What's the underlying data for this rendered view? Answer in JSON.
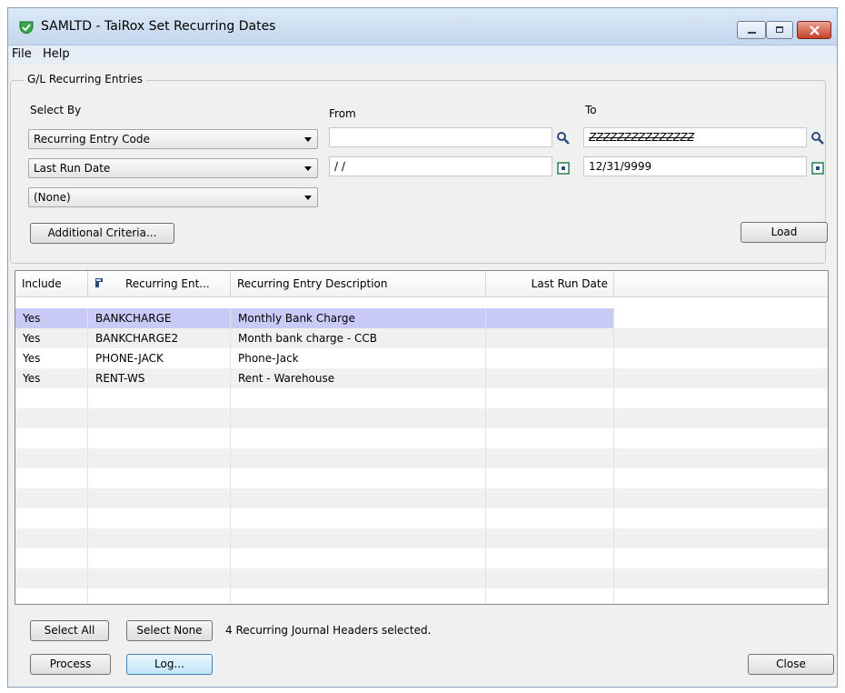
{
  "window": {
    "title": "SAMLTD - TaiRox Set Recurring Dates"
  },
  "menu": [
    "File",
    "Help"
  ],
  "criteria": {
    "group_label": "G/L Recurring Entries",
    "select_by_label": "Select By",
    "from_label": "From",
    "to_label": "To",
    "rows": [
      {
        "select_by": "Recurring Entry Code",
        "from": "",
        "to": "ZZZZZZZZZZZZZZZ",
        "icon": "search-icon"
      },
      {
        "select_by": "Last Run Date",
        "from": "/ /",
        "to": "12/31/9999",
        "icon": "calendar-icon"
      },
      {
        "select_by": "(None)"
      }
    ],
    "additional_criteria_label": "Additional Criteria...",
    "load_label": "Load"
  },
  "grid": {
    "columns": [
      "Include",
      "Recurring Ent...",
      "Recurring Entry Description",
      "Last Run Date"
    ],
    "rows": [
      {
        "include": "Yes",
        "code": "BANKCHARGE",
        "description": "Monthly Bank Charge",
        "last_run_date": ""
      },
      {
        "include": "Yes",
        "code": "BANKCHARGE2",
        "description": "Month bank charge - CCB",
        "last_run_date": ""
      },
      {
        "include": "Yes",
        "code": "PHONE-JACK",
        "description": "Phone-Jack",
        "last_run_date": ""
      },
      {
        "include": "Yes",
        "code": "RENT-WS",
        "description": "Rent - Warehouse",
        "last_run_date": ""
      }
    ]
  },
  "footer": {
    "select_all_label": "Select All",
    "select_none_label": "Select None",
    "status": "4 Recurring Journal Headers selected.",
    "process_label": "Process",
    "log_label": "Log...",
    "close_label": "Close"
  },
  "colors": {
    "selected_row": "#cacaf7",
    "alt_row": "#f0f0f0"
  }
}
